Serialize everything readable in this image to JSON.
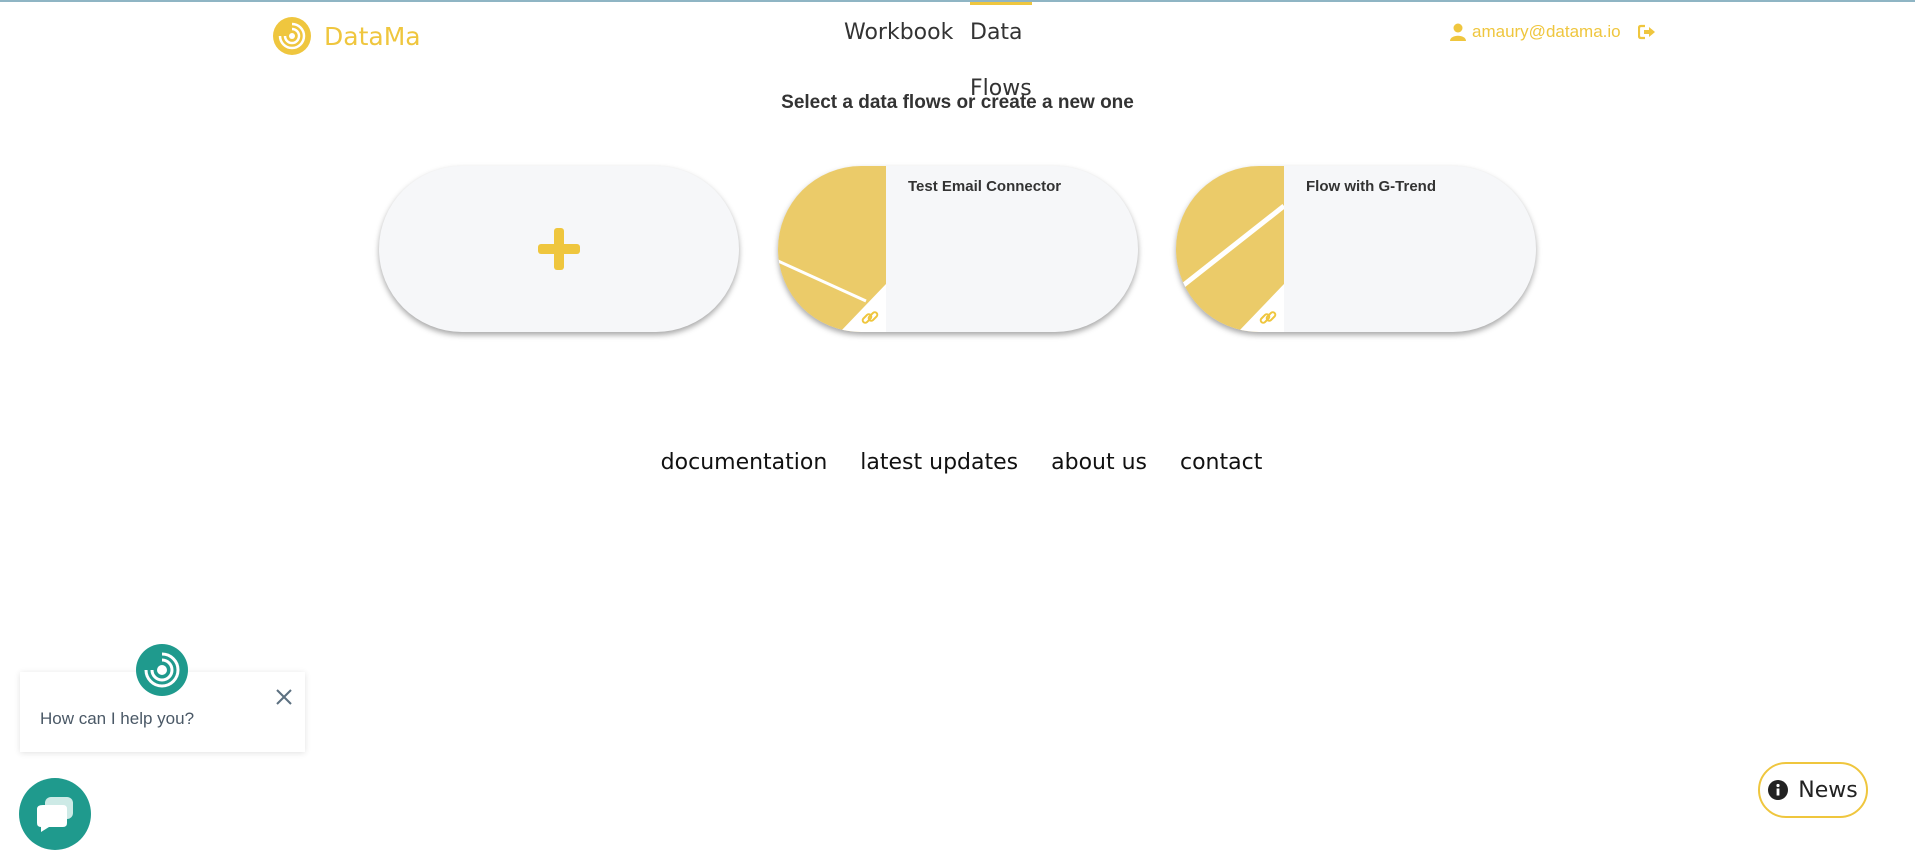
{
  "brand": {
    "name": "DataMa"
  },
  "nav": [
    {
      "label": "Workbook",
      "active": false
    },
    {
      "label": "Data Flows",
      "active": true
    }
  ],
  "user": {
    "email": "amaury@datama.io"
  },
  "page": {
    "subtitle": "Select a data flows or create a new one"
  },
  "flows": [
    {
      "title": "Test Email Connector"
    },
    {
      "title": "Flow with G-Trend"
    }
  ],
  "footer": {
    "links": [
      "documentation",
      "latest updates",
      "about us",
      "contact"
    ]
  },
  "chat": {
    "prompt": "How can I help you?"
  },
  "news": {
    "label": "News"
  },
  "colors": {
    "accent": "#efc63e",
    "chat": "#1f9a8d",
    "thumb": "#ebcb69"
  }
}
